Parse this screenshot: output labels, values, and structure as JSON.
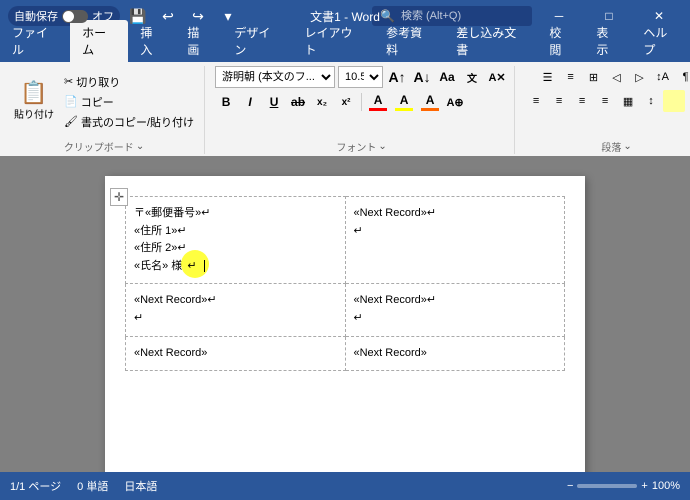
{
  "titlebar": {
    "autosave_label": "自動保存",
    "autosave_state": "オフ",
    "doc_name": "文書1 - Word",
    "search_placeholder": "検索 (Alt+Q)",
    "minimize_label": "─",
    "restore_label": "□",
    "close_label": "✕"
  },
  "ribbon": {
    "tabs": [
      "ファイル",
      "ホーム",
      "挿入",
      "描画",
      "デザイン",
      "レイアウト",
      "参考資料",
      "差し込み文書",
      "校閲",
      "表示",
      "ヘルプ"
    ],
    "active_tab": "ホーム",
    "groups": {
      "clipboard": {
        "label": "クリップボード",
        "paste_label": "貼り付け",
        "cut_label": "切り取り",
        "copy_label": "コピー",
        "format_copy_label": "書式のコピー/貼り付け"
      },
      "font": {
        "label": "フォント",
        "font_name": "游明朝 (本文のフ...",
        "font_size": "10.5",
        "bold_label": "B",
        "italic_label": "I",
        "underline_label": "U",
        "strikethrough_label": "ab",
        "subscript_label": "x₂",
        "superscript_label": "x²",
        "font_color_label": "A",
        "highlight_label": "A",
        "clear_label": "A"
      },
      "paragraph": {
        "label": "段落"
      }
    }
  },
  "document": {
    "table": {
      "cell1": {
        "line1": "〒«郵便番号»↵",
        "line2": "«住所 1»↵",
        "line3": "«住所 2»↵",
        "line4": "«氏名» 様↵"
      },
      "cell2": {
        "line1": "«Next Record»↵",
        "line2": "↵"
      },
      "cell3": {
        "line1": "«Next Record»↵",
        "line2": "↵"
      },
      "cell4": {
        "line1": "«Next Record»↵",
        "line2": "↵"
      },
      "cell5": {
        "line1": "«Next Record»",
        "line2": ""
      },
      "cell6": {
        "line1": "«Next Record»",
        "line2": ""
      }
    }
  },
  "statusbar": {
    "page_info": "1/1 ページ",
    "word_count": "0 単語",
    "language": "日本語",
    "zoom": "100%"
  }
}
